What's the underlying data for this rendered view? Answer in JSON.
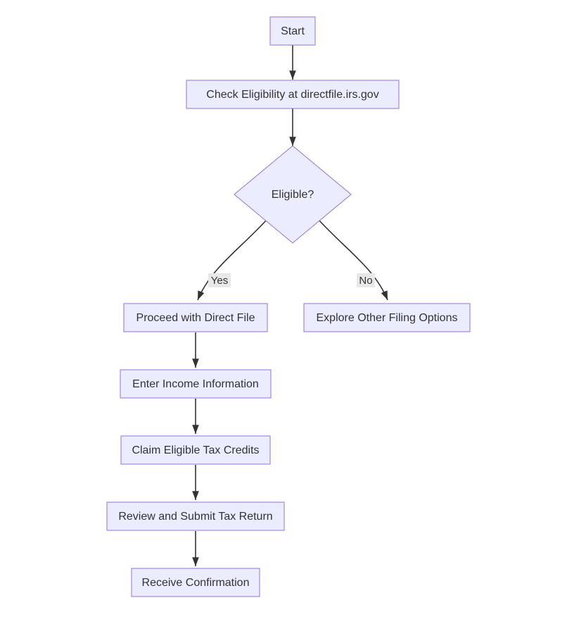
{
  "diagram": {
    "type": "flowchart",
    "nodes": {
      "start": {
        "label": "Start"
      },
      "check": {
        "label": "Check Eligibility at directfile.irs.gov"
      },
      "eligible": {
        "label": "Eligible?"
      },
      "proceed": {
        "label": "Proceed with Direct File"
      },
      "other": {
        "label": "Explore Other Filing Options"
      },
      "income": {
        "label": "Enter Income Information"
      },
      "credits": {
        "label": "Claim Eligible Tax Credits"
      },
      "review": {
        "label": "Review and Submit Tax Return"
      },
      "confirm": {
        "label": "Receive Confirmation"
      }
    },
    "edges": {
      "yes": {
        "label": "Yes"
      },
      "no": {
        "label": "No"
      }
    },
    "chart_data": {
      "type": "flowchart",
      "direction": "TD",
      "nodes": [
        {
          "id": "start",
          "shape": "rect",
          "label": "Start"
        },
        {
          "id": "check",
          "shape": "rect",
          "label": "Check Eligibility at directfile.irs.gov"
        },
        {
          "id": "eligible",
          "shape": "diamond",
          "label": "Eligible?"
        },
        {
          "id": "proceed",
          "shape": "rect",
          "label": "Proceed with Direct File"
        },
        {
          "id": "other",
          "shape": "rect",
          "label": "Explore Other Filing Options"
        },
        {
          "id": "income",
          "shape": "rect",
          "label": "Enter Income Information"
        },
        {
          "id": "credits",
          "shape": "rect",
          "label": "Claim Eligible Tax Credits"
        },
        {
          "id": "review",
          "shape": "rect",
          "label": "Review and Submit Tax Return"
        },
        {
          "id": "confirm",
          "shape": "rect",
          "label": "Receive Confirmation"
        }
      ],
      "edges": [
        {
          "from": "start",
          "to": "check"
        },
        {
          "from": "check",
          "to": "eligible"
        },
        {
          "from": "eligible",
          "to": "proceed",
          "label": "Yes"
        },
        {
          "from": "eligible",
          "to": "other",
          "label": "No"
        },
        {
          "from": "proceed",
          "to": "income"
        },
        {
          "from": "income",
          "to": "credits"
        },
        {
          "from": "credits",
          "to": "review"
        },
        {
          "from": "review",
          "to": "confirm"
        }
      ]
    }
  }
}
